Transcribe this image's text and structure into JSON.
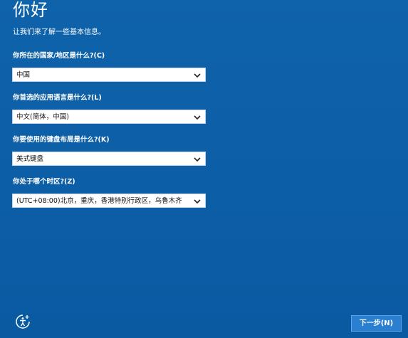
{
  "page": {
    "title": "你好",
    "subtitle": "让我们来了解一些基本信息。"
  },
  "fields": [
    {
      "label": "你所在的国家/地区是什么?(C)",
      "value": "中国"
    },
    {
      "label": "你首选的应用语言是什么?(L)",
      "value": "中文(简体，中国)"
    },
    {
      "label": "你要使用的键盘布局是什么?(K)",
      "value": "美式键盘"
    },
    {
      "label": "你处于哪个时区?(Z)",
      "value": "(UTC+08:00)北京，重庆，香港特别行政区，乌鲁木齐"
    }
  ],
  "footer": {
    "next_label": "下一步(N)",
    "accessibility_icon": "ease-of-access-icon"
  },
  "colors": {
    "background": "#0b5ea6",
    "button": "#2a7fd0"
  }
}
